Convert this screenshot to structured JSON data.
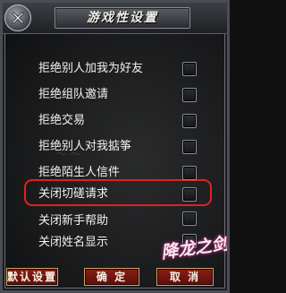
{
  "window": {
    "title": "游戏性设置"
  },
  "options": [
    {
      "label": "拒绝别人加我为好友",
      "checked": false
    },
    {
      "label": "拒绝组队邀请",
      "checked": false
    },
    {
      "label": "拒绝交易",
      "checked": false
    },
    {
      "label": "拒绝别人对我掂筝",
      "checked": false
    },
    {
      "label": "拒绝陌生人信件",
      "checked": false
    },
    {
      "label": "关闭切磋请求",
      "checked": false
    },
    {
      "label": "关闭新手帮助",
      "checked": false
    },
    {
      "label": "关闭姓名显示",
      "checked": false
    }
  ],
  "buttons": {
    "default": "默认设置",
    "ok": "确 定",
    "cancel": "取 消"
  },
  "logo": {
    "text": "降龙之剑"
  },
  "highlight_color": "#e0221d"
}
